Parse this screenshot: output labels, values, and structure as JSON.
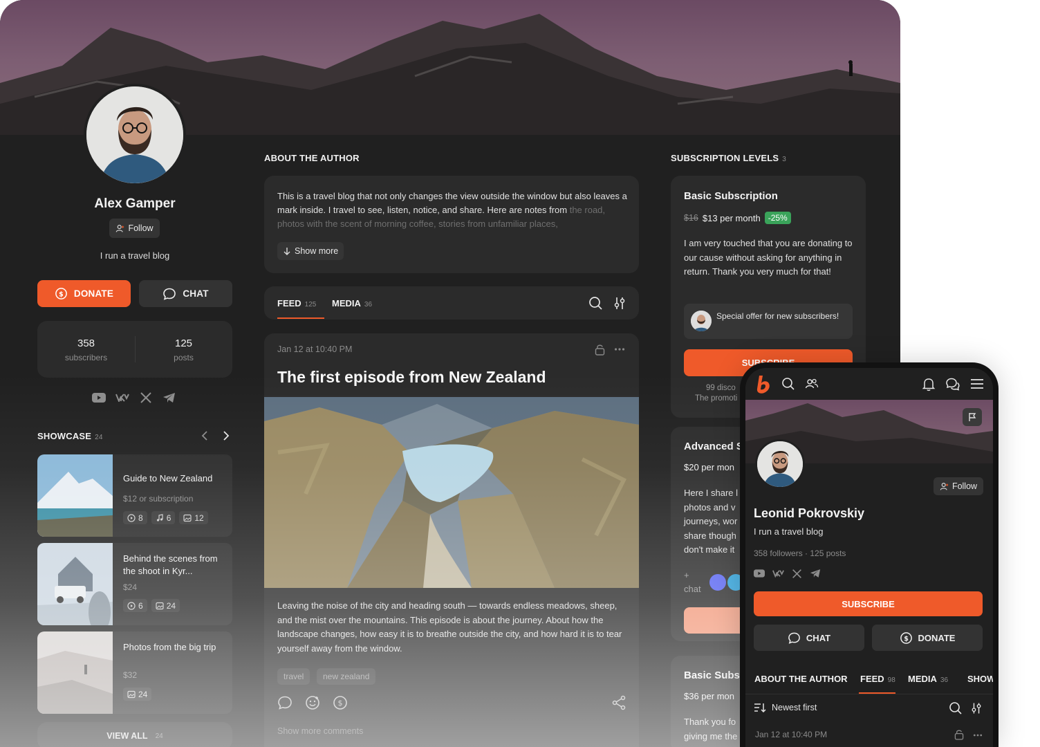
{
  "colors": {
    "accent": "#ef5a2a",
    "discount": "#3aa35a",
    "panel": "#2b2b2b",
    "background": "#202020"
  },
  "profile": {
    "name": "Alex Gamper",
    "follow_label": "Follow",
    "bio": "I run a travel blog",
    "donate_label": "DONATE",
    "chat_label": "CHAT",
    "stats": [
      {
        "value": "358",
        "label": "subscribers"
      },
      {
        "value": "125",
        "label": "posts"
      }
    ],
    "socials": [
      "youtube-icon",
      "vk-icon",
      "x-icon",
      "telegram-icon"
    ]
  },
  "showcase": {
    "title": "SHOWCASE",
    "count": "24",
    "view_all": "VIEW ALL",
    "view_all_count": "24",
    "items": [
      {
        "title": "Guide to New Zealand",
        "price": "$12 or subscription",
        "video": "8",
        "audio": "6",
        "images": "12"
      },
      {
        "title": "Behind the scenes from the shoot in Kyr...",
        "price": "$24",
        "video": "6",
        "images": "24"
      },
      {
        "title": "Photos from the big trip",
        "price": "$32",
        "images": "24"
      }
    ]
  },
  "about": {
    "title": "ABOUT THE AUTHOR",
    "text": "This is a travel blog that not only changes the view outside the window but also leaves a mark inside. I travel to see, listen, notice, and share. Here are notes from ",
    "text_faded": "the road, photos with the scent of morning coffee, stories from unfamiliar places,",
    "show_more": "Show more"
  },
  "feed_tabs": [
    {
      "label": "FEED",
      "count": "125"
    },
    {
      "label": "MEDIA",
      "count": "36"
    }
  ],
  "post": {
    "date": "Jan 12 at 10:40 PM",
    "title": "The first episode from New Zealand",
    "body": "Leaving the noise of the city and heading south — towards endless meadows, sheep, and the mist over the mountains. This episode is about the journey. About how the landscape changes, how easy it is to breathe outside the city, and how hard it is to tear yourself away from the window.",
    "tags": [
      "travel",
      "new zealand"
    ],
    "comments_link": "Show more comments"
  },
  "subscriptions": {
    "title": "SUBSCRIPTION LEVELS",
    "count": "3",
    "basic": {
      "name": "Basic Subscription",
      "old_price": "$16",
      "price": "$13 per month",
      "discount": "-25%",
      "description": "I am very touched that you are donating to our cause without asking for anything in return. Thank you very much for that!",
      "offer": "Special offer for new subscribers!",
      "button": "SUBSCRIBE",
      "note1": "99 disco",
      "note2": "The promoti"
    },
    "advanced": {
      "name": "Advanced S",
      "price": "$20 per mon",
      "desc_lines": [
        "Here I share l",
        "photos and v",
        "journeys, wor",
        "share though",
        "don't make it"
      ],
      "chat_plus": "+",
      "chat": "chat"
    },
    "basic2": {
      "name": "Basic Subs",
      "price": "$36 per mon",
      "desc_lines": [
        "Thank you fo",
        "giving me the"
      ]
    }
  },
  "phone": {
    "name": "Leonid Pokrovskiy",
    "bio": "I run a travel blog",
    "follow_label": "Follow",
    "stats": "358 followers · 125 posts",
    "subscribe": "SUBSCRIBE",
    "chat": "CHAT",
    "donate": "DONATE",
    "tabs": [
      {
        "label": "ABOUT THE AUTHOR",
        "count": ""
      },
      {
        "label": "FEED",
        "count": "98"
      },
      {
        "label": "MEDIA",
        "count": "36"
      },
      {
        "label": "SHOW",
        "count": ""
      }
    ],
    "sort": "Newest first",
    "date": "Jan 12 at 10:40 PM"
  }
}
